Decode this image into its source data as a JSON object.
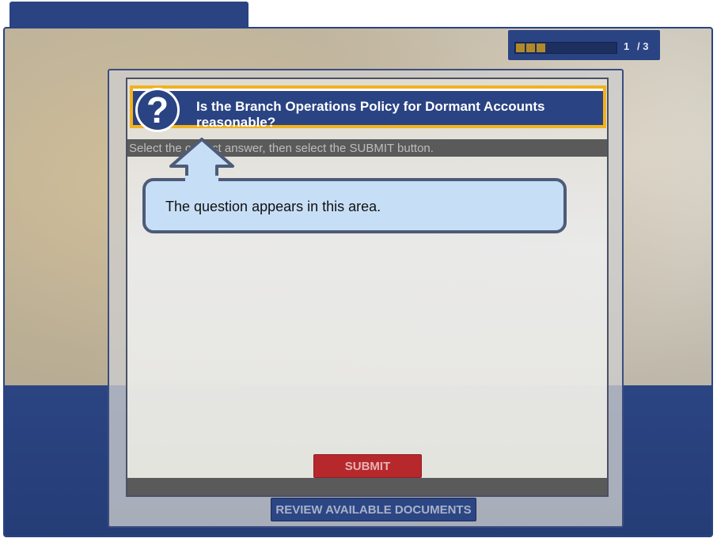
{
  "progress": {
    "current": "1",
    "total": "/ 3",
    "filled_segments": 3,
    "segment_color": "#b08a2a"
  },
  "question": {
    "icon": "question-mark-icon",
    "icon_glyph": "?",
    "text": "Is the Branch Operations Policy for Dormant Accounts reasonable?"
  },
  "instruction": "Select the correct answer, then select the SUBMIT button.",
  "buttons": {
    "submit": "SUBMIT",
    "review": "REVIEW AVAILABLE DOCUMENTS"
  },
  "callout": {
    "text": "The question appears in this area."
  },
  "colors": {
    "brand_blue": "#2a4383",
    "highlight_orange": "#f2b21f",
    "submit_red": "#b6282c",
    "callout_fill": "#c7dff6"
  }
}
